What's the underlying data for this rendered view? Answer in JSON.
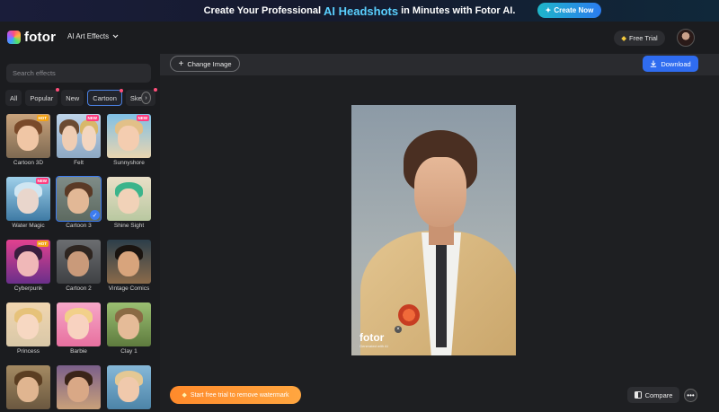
{
  "promo": {
    "text_before": "Create Your Professional",
    "highlight": "AI Headshots",
    "text_after": "in Minutes with Fotor AI.",
    "cta_label": "Create Now",
    "accent": "#5ad0ff"
  },
  "header": {
    "logo_text": "fotor",
    "nav_label": "AI Art Effects",
    "free_trial_label": "Free Trial"
  },
  "sidebar": {
    "search_placeholder": "Search effects",
    "tabs": [
      {
        "label": "All"
      },
      {
        "label": "Popular"
      },
      {
        "label": "New"
      },
      {
        "label": "Cartoon"
      },
      {
        "label": "Sketch"
      }
    ],
    "active_tab": "Cartoon",
    "effects": [
      {
        "label": "Cartoon 3D",
        "badge": "HOT"
      },
      {
        "label": "Felt",
        "badge": "NEW"
      },
      {
        "label": "Sunnyshore",
        "badge": "NEW"
      },
      {
        "label": "Water Magic",
        "badge": "NEW"
      },
      {
        "label": "Cartoon 3",
        "badge": "",
        "selected": true
      },
      {
        "label": "Shine Sight",
        "badge": ""
      },
      {
        "label": "Cyberpunk",
        "badge": "HOT"
      },
      {
        "label": "Cartoon 2",
        "badge": ""
      },
      {
        "label": "Vintage Comics",
        "badge": ""
      },
      {
        "label": "Princess",
        "badge": ""
      },
      {
        "label": "Barbie",
        "badge": ""
      },
      {
        "label": "Clay 1",
        "badge": ""
      },
      {
        "label": "",
        "badge": ""
      },
      {
        "label": "",
        "badge": ""
      },
      {
        "label": "",
        "badge": ""
      }
    ]
  },
  "toolbar": {
    "change_image_label": "Change Image",
    "download_label": "Download"
  },
  "canvas": {
    "watermark_brand": "fotor",
    "watermark_sub": "Generated with AI",
    "trial_label": "Start free trial to remove watermark",
    "compare_label": "Compare"
  },
  "colors": {
    "primary": "#2f6cf0",
    "trial": "#ff8a2b",
    "badge_new": "#ff3d7f",
    "badge_hot": "#f3a316"
  }
}
